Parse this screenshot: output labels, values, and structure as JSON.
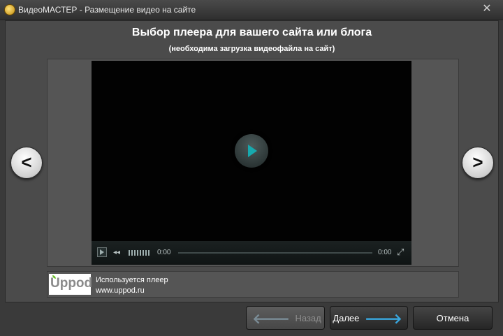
{
  "window": {
    "title": "ВидеоМАСТЕР - Размещение видео на сайте",
    "close_symbol": "✕"
  },
  "main": {
    "heading": "Выбор плеера для вашего сайта или блога",
    "subheading": "(необходима загрузка видеофайла на сайт)"
  },
  "player": {
    "current_time": "0:00",
    "duration": "0:00",
    "progress": 0
  },
  "nav": {
    "prev_symbol": "<",
    "next_symbol": ">"
  },
  "info": {
    "logo_text": "Uppod",
    "line1": "Используется плеер",
    "line2": "www.uppod.ru"
  },
  "buttons": {
    "back_label": "Назад",
    "next_label": "Далее",
    "cancel_label": "Отмена",
    "back_arrow": "🡐",
    "next_arrow": "🡒"
  },
  "colors": {
    "accent_play": "#17a9ae",
    "accent_arrow": "#39a8e0"
  }
}
